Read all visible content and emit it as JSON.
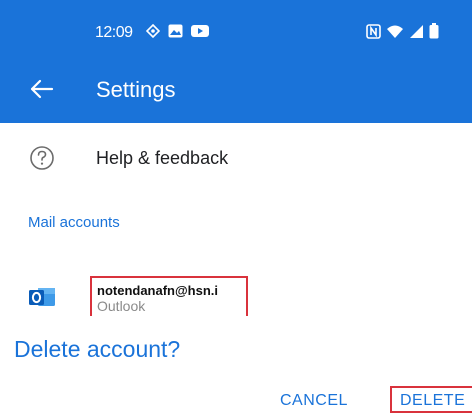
{
  "status_bar": {
    "time": "12:09",
    "left_icons": [
      "location-icon",
      "image-icon",
      "youtube-icon"
    ],
    "right_icons": [
      "nfc-icon",
      "wifi-icon",
      "signal-icon",
      "battery-icon"
    ]
  },
  "app_bar": {
    "title": "Settings",
    "color": "#1a73d9"
  },
  "help": {
    "label": "Help & feedback",
    "icon": "help-icon"
  },
  "mail_accounts": {
    "section_label": "Mail accounts",
    "accounts": [
      {
        "email": "notendanafn@hsn.i",
        "type": "Outlook",
        "icon": "outlook-icon"
      }
    ]
  },
  "dialog": {
    "title": "Delete account?",
    "cancel_label": "CANCEL",
    "delete_label": "DELETE"
  },
  "colors": {
    "accent": "#1a73d9",
    "highlight": "#d9323c"
  }
}
